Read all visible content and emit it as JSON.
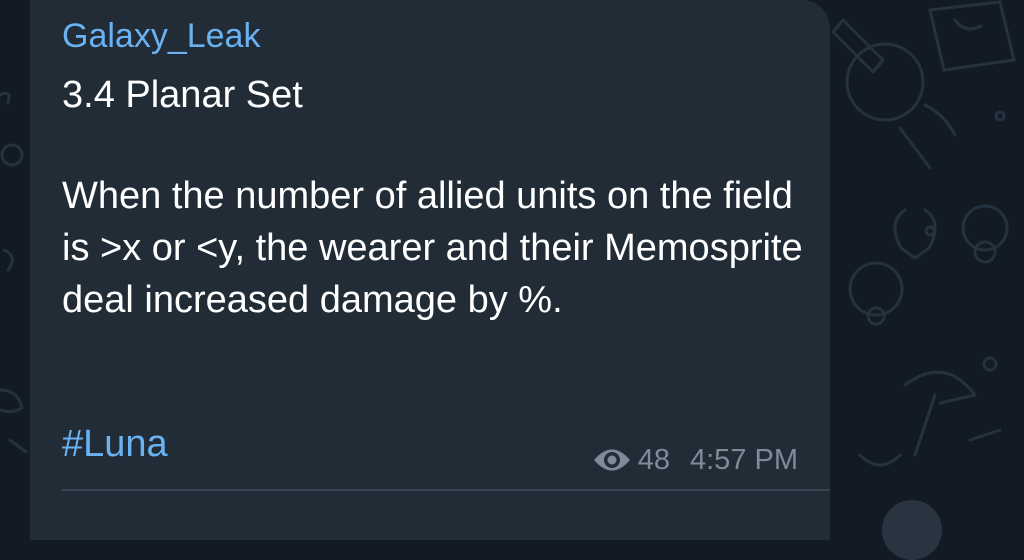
{
  "message": {
    "sender": "Galaxy_Leak",
    "title": "3.4 Planar Set",
    "body": "When the number of allied units on the field is >x or <y, the wearer and their Memosprite deal increased damage by %.",
    "hashtag": "#Luna",
    "views": "48",
    "time": "4:57 PM",
    "views_icon": "eye-icon"
  },
  "colors": {
    "background": "#121b23",
    "bubble": "#212c37",
    "accent": "#6ab2f2",
    "text": "#ffffff",
    "meta": "#7e8b98"
  }
}
